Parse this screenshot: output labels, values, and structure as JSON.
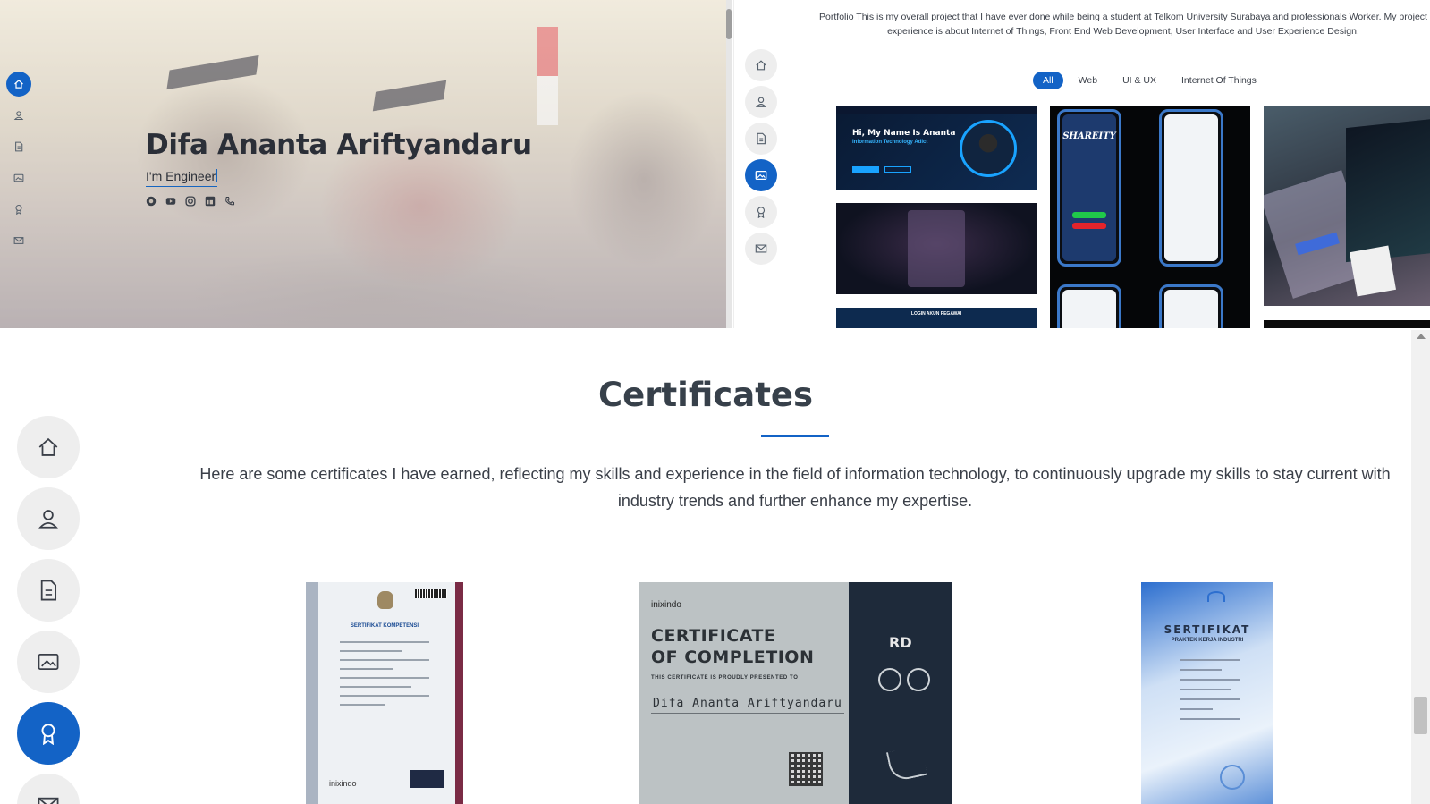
{
  "hero": {
    "name": "Difa Ananta Ariftyandaru",
    "typed_text": "I'm Engineer",
    "social_icons": [
      "github-icon",
      "youtube-icon",
      "instagram-icon",
      "linkedin-icon",
      "phone-icon"
    ]
  },
  "nav": {
    "icons": [
      "home-icon",
      "user-icon",
      "resume-icon",
      "portfolio-icon",
      "certificate-icon",
      "mail-icon"
    ],
    "active_panel1": "home-icon",
    "active_panel2": "portfolio-icon",
    "active_panel3": "certificate-icon",
    "accent": "#1363c6"
  },
  "portfolio": {
    "intro": "Portfolio This is my overall project that I have ever done while being a student at Telkom University Surabaya and professionals Worker. My project experience is about Internet of Things, Front End Web Development, User Interface and User Experience Design.",
    "filters": [
      {
        "label": "All",
        "active": true
      },
      {
        "label": "Web",
        "active": false
      },
      {
        "label": "UI & UX",
        "active": false
      },
      {
        "label": "Internet Of Things",
        "active": false
      }
    ],
    "thumb1_heading": "Hi, My Name Is Ananta",
    "thumb1_sub": "Information Technology Adict",
    "thumb3_caption": "LOGIN AKUN PEGAWAI",
    "thumb4_app_title": "SHAREITY"
  },
  "certificates": {
    "title": "Certificates",
    "description": "Here are some certificates I have earned, reflecting my skills and experience in the field of information technology, to continuously upgrade my skills to stay current with industry trends and further enhance my expertise.",
    "cert1": {
      "heading": "SERTIFIKAT KOMPETENSI",
      "issuer_logo": "inixindo"
    },
    "cert2": {
      "brand": "inixindo",
      "heading_line1": "CERTIFICATE",
      "heading_line2": "OF COMPLETION",
      "presented": "THIS CERTIFICATE IS PROUDLY PRESENTED TO",
      "recipient": "Difa Ananta Ariftyandaru",
      "mark": "RD"
    },
    "cert3": {
      "heading": "SERTIFIKAT",
      "subheading": "PRAKTEK KERJA INDUSTRI"
    }
  }
}
